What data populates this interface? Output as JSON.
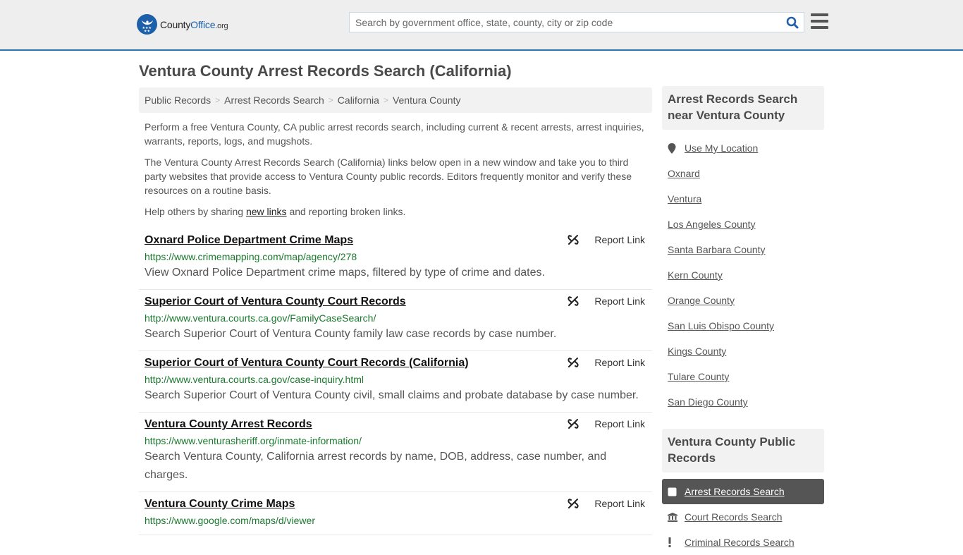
{
  "header": {
    "logo": {
      "county": "County",
      "office": "Office",
      "org": ".org"
    },
    "search_placeholder": "Search by government office, state, county, city or zip code",
    "accent_color": "#2d75b0"
  },
  "page_title": "Ventura County Arrest Records Search (California)",
  "breadcrumb": [
    "Public Records",
    "Arrest Records Search",
    "California",
    "Ventura County"
  ],
  "intro": {
    "p1": "Perform a free Ventura County, CA public arrest records search, including current & recent arrests, arrest inquiries, warrants, reports, logs, and mugshots.",
    "p2": "The Ventura County Arrest Records Search (California) links below open in a new window and take you to third party websites that provide access to Ventura County public records. Editors frequently monitor and verify these resources on a routine basis.",
    "p3_before": "Help others by sharing ",
    "p3_link": "new links",
    "p3_after": " and reporting broken links."
  },
  "report_label": "Report Link",
  "links": [
    {
      "title": "Oxnard Police Department Crime Maps",
      "url": "https://www.crimemapping.com/map/agency/278",
      "desc": "View Oxnard Police Department crime maps, filtered by type of crime and dates."
    },
    {
      "title": "Superior Court of Ventura County Court Records",
      "url": "http://www.ventura.courts.ca.gov/FamilyCaseSearch/",
      "desc": "Search Superior Court of Ventura County family law case records by case number."
    },
    {
      "title": "Superior Court of Ventura County Court Records (California)",
      "url": "http://www.ventura.courts.ca.gov/case-inquiry.html",
      "desc": "Search Superior Court of Ventura County civil, small claims and probate database by case number."
    },
    {
      "title": "Ventura County Arrest Records",
      "url": "https://www.venturasheriff.org/inmate-information/",
      "desc": "Search Ventura County, California arrest records by name, DOB, address, case number, and charges."
    },
    {
      "title": "Ventura County Crime Maps",
      "url": "https://www.google.com/maps/d/viewer",
      "desc": ""
    }
  ],
  "sidebar": {
    "nearby_heading": "Arrest Records Search near Ventura County",
    "use_location": "Use My Location",
    "nearby": [
      "Oxnard",
      "Ventura",
      "Los Angeles County",
      "Santa Barbara County",
      "Kern County",
      "Orange County",
      "San Luis Obispo County",
      "Kings County",
      "Tulare County",
      "San Diego County"
    ],
    "records_heading": "Ventura County Public Records",
    "records_nav": [
      {
        "label": "Arrest Records Search",
        "icon": "square-icon",
        "active": true
      },
      {
        "label": "Court Records Search",
        "icon": "courthouse-icon",
        "active": false
      },
      {
        "label": "Criminal Records Search",
        "icon": "exclamation-icon",
        "active": false
      }
    ]
  }
}
